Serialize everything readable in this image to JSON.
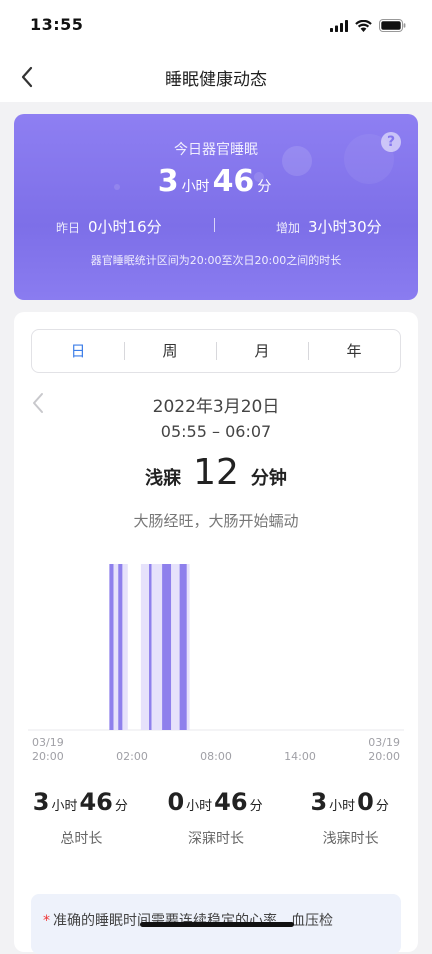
{
  "status": {
    "time": "13:55"
  },
  "header": {
    "title": "睡眠健康动态"
  },
  "summary": {
    "title": "今日器官睡眠",
    "hours": "3",
    "hours_unit": "小时",
    "minutes": "46",
    "minutes_unit": "分",
    "yesterday_label": "昨日",
    "yesterday_value": "0小时16分",
    "increase_label": "增加",
    "increase_value": "3小时30分",
    "note": "器官睡眠统计区间为20:00至次日20:00之间的时长",
    "help_symbol": "?"
  },
  "tabs": [
    {
      "label": "日",
      "active": true
    },
    {
      "label": "周",
      "active": false
    },
    {
      "label": "月",
      "active": false
    },
    {
      "label": "年",
      "active": false
    }
  ],
  "day": {
    "date": "2022年3月20日",
    "range": "05:55 – 06:07",
    "stage_name": "浅寐",
    "stage_minutes": "12",
    "stage_unit": "分钟",
    "description": "大肠经旺，大肠开始蠕动"
  },
  "chart_data": {
    "type": "bar",
    "title": "",
    "x_axis": {
      "start": "03/19 20:00",
      "end": "03/20 20:00",
      "ticks": [
        {
          "label": "03/19 20:00",
          "line1": "03/19",
          "line2": "20:00",
          "hour": 0
        },
        {
          "label": "02:00",
          "hour": 6
        },
        {
          "label": "08:00",
          "hour": 12
        },
        {
          "label": "14:00",
          "hour": 18
        },
        {
          "label": "03/20 20:00",
          "line1": "03/19",
          "line2": "20:00",
          "hour": 24
        }
      ]
    },
    "y_axis": {
      "levels": [
        "浅寐",
        "深寐"
      ]
    },
    "segments": [
      {
        "start": "00:23",
        "end": "00:41",
        "stage": "深寐"
      },
      {
        "start": "00:41",
        "end": "01:01",
        "stage": "浅寐"
      },
      {
        "start": "01:01",
        "end": "01:19",
        "stage": "深寐"
      },
      {
        "start": "01:19",
        "end": "01:42",
        "stage": "浅寐"
      },
      {
        "start": "02:38",
        "end": "03:13",
        "stage": "浅寐"
      },
      {
        "start": "03:13",
        "end": "03:24",
        "stage": "深寐"
      },
      {
        "start": "03:24",
        "end": "04:09",
        "stage": "浅寐"
      },
      {
        "start": "04:09",
        "end": "04:48",
        "stage": "深寐"
      },
      {
        "start": "04:48",
        "end": "05:24",
        "stage": "浅寐"
      },
      {
        "start": "05:24",
        "end": "05:55",
        "stage": "深寐"
      },
      {
        "start": "05:55",
        "end": "06:07",
        "stage": "浅寐"
      }
    ],
    "colors": {
      "深寐": "#8e80ec",
      "浅寐": "#e6e2fb",
      "axis": "#e8e8ec",
      "tick_text": "#a0a0a6"
    }
  },
  "stats": [
    {
      "num1": "3",
      "unit1": "小时",
      "num2": "46",
      "unit2": "分",
      "label": "总时长"
    },
    {
      "num1": "0",
      "unit1": "小时",
      "num2": "46",
      "unit2": "分",
      "label": "深寐时长"
    },
    {
      "num1": "3",
      "unit1": "小时",
      "num2": "0",
      "unit2": "分",
      "label": "浅寐时长"
    }
  ],
  "notice": {
    "star": "*",
    "text": "准确的睡眠时间需要连续稳定的心率、血压检"
  }
}
